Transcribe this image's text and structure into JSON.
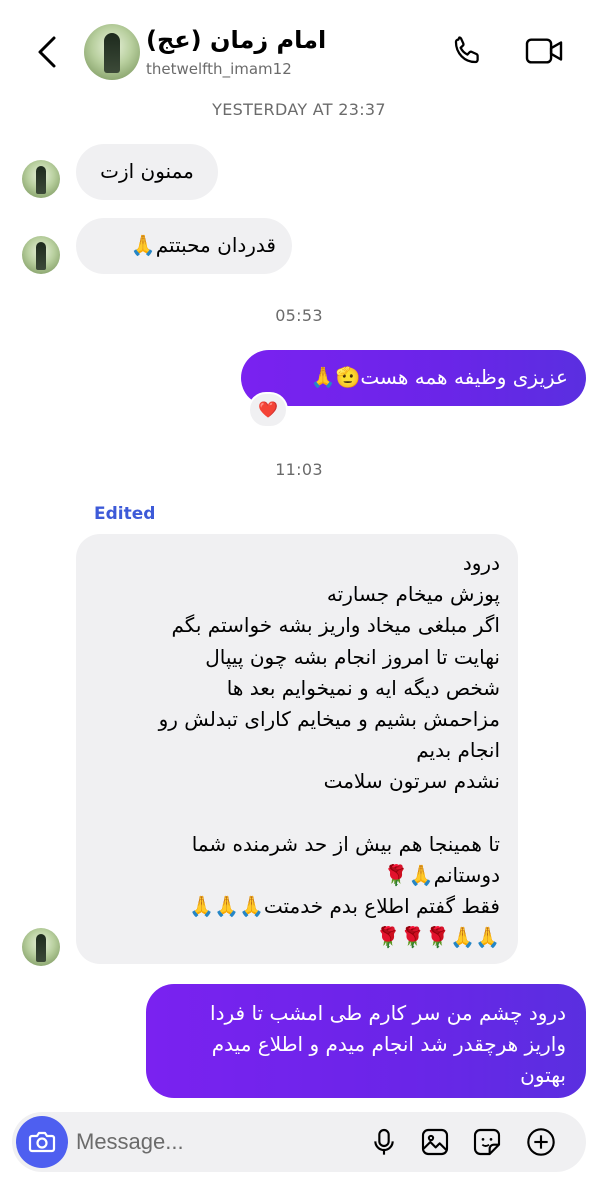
{
  "header": {
    "title": "امام زمان (عج)",
    "username": "thetwelfth_imam12",
    "icons": {
      "back": "chevron-left-icon",
      "call": "phone-icon",
      "video": "video-camera-icon"
    }
  },
  "timestamps": {
    "t1": "YESTERDAY AT 23:37",
    "t2": "05:53",
    "t3": "11:03"
  },
  "messages": {
    "m1": "ممنون ازت",
    "m2": "قدردان محبتتم🙏",
    "m3": "عزیزی وظیفه همه هست🫡🙏",
    "m3_reaction": "❤️",
    "m4_edited": "Edited",
    "m4": "درود\nپوزش میخام جسارته\nاگر مبلغی میخاد واریز بشه خواستم بگم\nنهایت تا امروز انجام بشه چون پیپال\nشخص دیگه ایه و نمیخوایم بعد ها\nمزاحمش بشیم و میخایم کارای تبدلش رو\nانجام بدیم\nنشدم سرتون سلامت\n\nتا همینجا هم بیش از حد شرمنده شما\nدوستانم🙏🌹\nفقط گفتم اطلاع بدم خدمتت🙏🙏🙏\n🌹🌹🌹🙏🙏",
    "m5": "درود چشم من سر کارم طی امشب تا فردا واریز هرچقدر شد انجام میدم و اطلاع میدم بهتون"
  },
  "composer": {
    "placeholder": "Message...",
    "icons": [
      "camera-icon",
      "microphone-icon",
      "gallery-icon",
      "sticker-icon",
      "plus-circle-icon"
    ]
  },
  "colors": {
    "outgoing_start": "#7a22f0",
    "outgoing_end": "#5a2fe0",
    "incoming": "#f0f0f2",
    "camera_button": "#4e5ff0",
    "edited": "#3d5ad8"
  }
}
